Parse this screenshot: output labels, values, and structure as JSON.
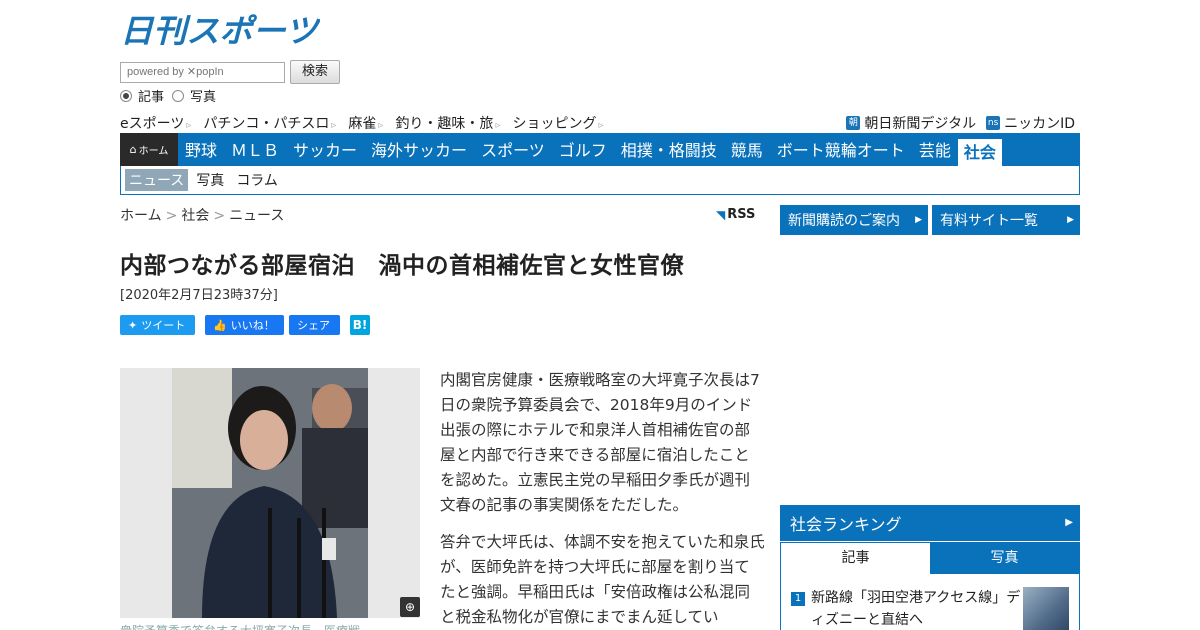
{
  "brand": {
    "logo_text": "日刊スポーツ",
    "color": "#1a74b6"
  },
  "search": {
    "placeholder": "powered by ✕popIn",
    "button": "検索",
    "options": [
      "記事",
      "写真"
    ],
    "selected": "記事"
  },
  "subnav": {
    "left": [
      "eスポーツ",
      "パチンコ・パチスロ",
      "麻雀",
      "釣り・趣味・旅",
      "ショッピング"
    ],
    "right": [
      {
        "icon": "朝",
        "label": "朝日新聞デジタル"
      },
      {
        "icon": "ns",
        "label": "ニッカンID"
      }
    ]
  },
  "mainnav": {
    "home": "ホーム",
    "items": [
      "野球",
      "ＭＬＢ",
      "サッカー",
      "海外サッカー",
      "スポーツ",
      "ゴルフ",
      "相撲・格闘技",
      "競馬",
      "ボート競輪オート",
      "芸能",
      "社会"
    ],
    "active": "社会"
  },
  "secnav": {
    "items": [
      "ニュース",
      "写真",
      "コラム"
    ],
    "active": "ニュース"
  },
  "breadcrumb": [
    "ホーム",
    "社会",
    "ニュース"
  ],
  "rss": "RSS",
  "article": {
    "title": "内部つながる部屋宿泊　渦中の首相補佐官と女性官僚",
    "date": "[2020年2月7日23時37分]",
    "share": {
      "tweet": "ツイート",
      "like": "いいね！",
      "share": "シェア",
      "hatena": "B!"
    },
    "caption": "衆院予算委で答弁する大坪寛子次長　医療戦",
    "paragraphs": [
      "内閣官房健康・医療戦略室の大坪寛子次長は7日の衆院予算委員会で、2018年9月のインド出張の際にホテルで和泉洋人首相補佐官の部屋と内部で行き来できる部屋に宿泊したことを認めた。立憲民主党の早稲田夕季氏が週刊文春の記事の事実関係をただした。",
      "答弁で大坪氏は、体調不安を抱えていた和泉氏が、医師免許を持つ大坪氏に部屋を割り当てたと強調。早稲田氏は「安倍政権は公私混同と税金私物化が官僚にまでまん延してい"
    ]
  },
  "sidebar": {
    "buttons": [
      "新聞購読のご案内",
      "有料サイト一覧"
    ],
    "ranking": {
      "title": "社会ランキング",
      "tabs": [
        "記事",
        "写真"
      ],
      "active_tab": "記事",
      "items": [
        {
          "rank": "1",
          "text": "新路線「羽田空港アクセス線」ディズニーと直結へ"
        }
      ]
    }
  }
}
